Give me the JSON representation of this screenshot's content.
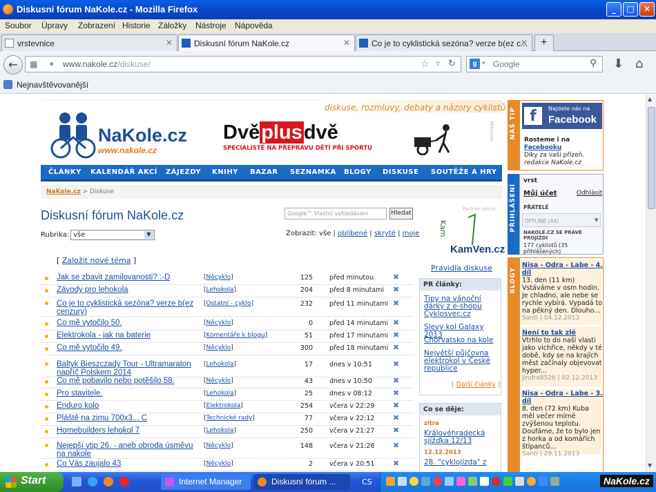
{
  "window": {
    "title": "Diskusní fórum NaKole.cz - Mozilla Firefox",
    "min": "_",
    "max": "□",
    "close": "✕"
  },
  "menu": [
    "Soubor",
    "Úpravy",
    "Zobrazení",
    "Historie",
    "Záložky",
    "Nástroje",
    "Nápověda"
  ],
  "tabs": [
    {
      "label": "vrstevnice",
      "close": "✕"
    },
    {
      "label": "Diskusní fórum NaKole.cz",
      "close": "✕"
    },
    {
      "label": "Co je to cyklistická sezóna? verze b(ez c...",
      "close": "✕"
    }
  ],
  "newtab": "+",
  "nav": {
    "url_domain": "www.nakole.cz",
    "url_path": "/diskuse/",
    "search_placeholder": "Google"
  },
  "bookmarks": {
    "item": "Nejnavštěvovanější"
  },
  "page": {
    "slogan": "diskuse, rozmluvy, debaty a názory cyklistů",
    "logo": "NaKole.cz",
    "logo_sub": "www.nakole.cz",
    "banner_title_a": "Dvě",
    "banner_title_b": "plus",
    "banner_title_c": "dvě",
    "banner_sub": "SPECIALISTÉ NA PŘEPRAVU DĚTÍ PŘI SPORTU",
    "reklama": "Reklama",
    "nav_items": [
      "ČLÁNKY",
      "KALENDÁŘ AKCÍ",
      "ZÁJEZDY",
      "KNIHY",
      "BAZAR",
      "SEZNAMKA",
      "BLOGY",
      "DISKUSE",
      "SOUTĚŽE A HRY"
    ],
    "crumb_home": "NaKole.cz",
    "crumb_current": "> Diskuse",
    "title": "Diskusní fórum NaKole.cz",
    "google_placeholder": "Google™ Vlastní vyhledávání",
    "search_button": "Hledat",
    "rubrika_label": "Rubrika:",
    "rubrika_value": "vše",
    "zobrazit_label": "Zobrazit:",
    "zobrazit_opts": [
      "vše",
      "oblíbené",
      "skryté",
      "moje"
    ],
    "new_topic": "Založit nové téma",
    "bracket_open": "[",
    "bracket_close": "]",
    "partner_label": "Partner sekce",
    "partner_name": "KamVen.cz",
    "rules": "Pravidla diskuse",
    "topics": [
      {
        "title": "Jak se zbavit zamilovanosti? :-D",
        "cat": "Něcyklo",
        "count": "125",
        "time": "před minutou"
      },
      {
        "title": "Závody pro lehokola",
        "cat": "Lehokola",
        "count": "204",
        "time": "před 8 minutami"
      },
      {
        "title": "Co je to cyklistická sezóna? verze b(ez cenzury)",
        "cat": "Ostatní - cyklo",
        "count": "232",
        "time": "před 11 minutami"
      },
      {
        "title": "Co mě vytočilo 50.",
        "cat": "Něcyklo",
        "count": "0",
        "time": "před 14 minutami"
      },
      {
        "title": "Elektrokola - jak na baterie",
        "cat": "Komentáře k blogu",
        "count": "51",
        "time": "před 17 minutami"
      },
      {
        "title": "Co mě vytočilo 49.",
        "cat": "Něcyklo",
        "count": "300",
        "time": "před 18 minutami"
      },
      {
        "title": "Baltyk Bieszczady Tour - Ultramaraton napříč Polskem 2014",
        "cat": "Lehokola",
        "count": "17",
        "time": "dnes v 10:51"
      },
      {
        "title": "Co mě pobavilo nebo potěšilo 58.",
        "cat": "Něcyklo",
        "count": "43",
        "time": "dnes v 10:50"
      },
      {
        "title": "Pro stavitele.",
        "cat": "Lehokola",
        "count": "25",
        "time": "dnes v 08:12"
      },
      {
        "title": "Enduro kolo",
        "cat": "Elektrokola",
        "count": "254",
        "time": "včera v 22:29"
      },
      {
        "title": "Pláště na zimu 700x3... C",
        "cat": "Technické rady",
        "count": "77",
        "time": "včera v 22:12"
      },
      {
        "title": "Homebuilders lehokol 7",
        "cat": "Lehokola",
        "count": "250",
        "time": "včera v 21:27"
      },
      {
        "title": "Nejepší vtip 26. - aneb obroda úsměvu na nakole",
        "cat": "Něcyklo",
        "count": "148",
        "time": "včera v 21:26"
      },
      {
        "title": "Co Vás zaujalo 43",
        "cat": "Něcyklo",
        "count": "2",
        "time": "včera v 20:51"
      }
    ],
    "delete_mark": "✖",
    "pr_head": "PR články:",
    "pr_links": [
      "Tipy na vánoční dárky z e-shopu Cyklosvec.cz",
      "Slevy kol Galaxy 2013",
      "Chorvatsko na kole",
      "Největší půjčovna elektrokol v České republice"
    ],
    "pr_more": "Další články",
    "events_head": "Co se děje:",
    "events_date1": "zítra",
    "events_link1": "Královéhradecká sjížďka 12/13",
    "events_date2": "12.12.2013",
    "events_link2": "28. \"cyklojízda\" z"
  },
  "sidebar": {
    "tip_label": "NÁŠ TIP",
    "fb_line1": "Najdete nás na",
    "fb_line2": "Facebook",
    "fb_text1": "Rosteme i na",
    "fb_link": "Facebooku",
    "fb_text2": "Díky za vaši přízeň.",
    "fb_text3": "redakce NaKole.cz",
    "login_label": "PŘIHLÁŠENÍ",
    "user": "vrst",
    "my_account": "Můj účet",
    "logout": "Odhlásit",
    "friends": "PŘÁTELÉ",
    "offline": "OFFLINE (44)",
    "browsing": "NAKOLE.CZ SE PRÁVĚ PROJÍŽDÍ",
    "riders": "177 cyklistů (35 přihlášených)",
    "blogs_label": "BLOGY",
    "blogs": [
      {
        "title": "Nisa - Odra - Labe - 4. díl",
        "text": "13. den (11 km) Vstáváme v osm hodin. Je chladno, ale nebe se rychle vybírá. Vypadá to na pěkný den. Dlouho...",
        "author": "Santi",
        "date": "04.12.2013"
      },
      {
        "title": "Není to tak zlé",
        "text": "Vtrhlo to do naší vlasti jako vichřice, někdy v té době, kdy se na krajích měst začínaly objevovat hyper...",
        "author": "Jindra8526",
        "date": "02.12.2013"
      },
      {
        "title": "Nisa - Odra - Labe - 3. díl",
        "text": "8. den (72 km) Kuba měl večer mírně zvýšenou teplotu. Doufáme, že to bylo jen z horka a od komářích štípanců...",
        "author": "Santi",
        "date": "29.11.2013"
      }
    ]
  },
  "taskbar": {
    "start": "Start",
    "task1": "Internet Manager",
    "task2": "Diskusní fórum ...",
    "lang": "CS",
    "watermark": "NaKole.cz"
  }
}
